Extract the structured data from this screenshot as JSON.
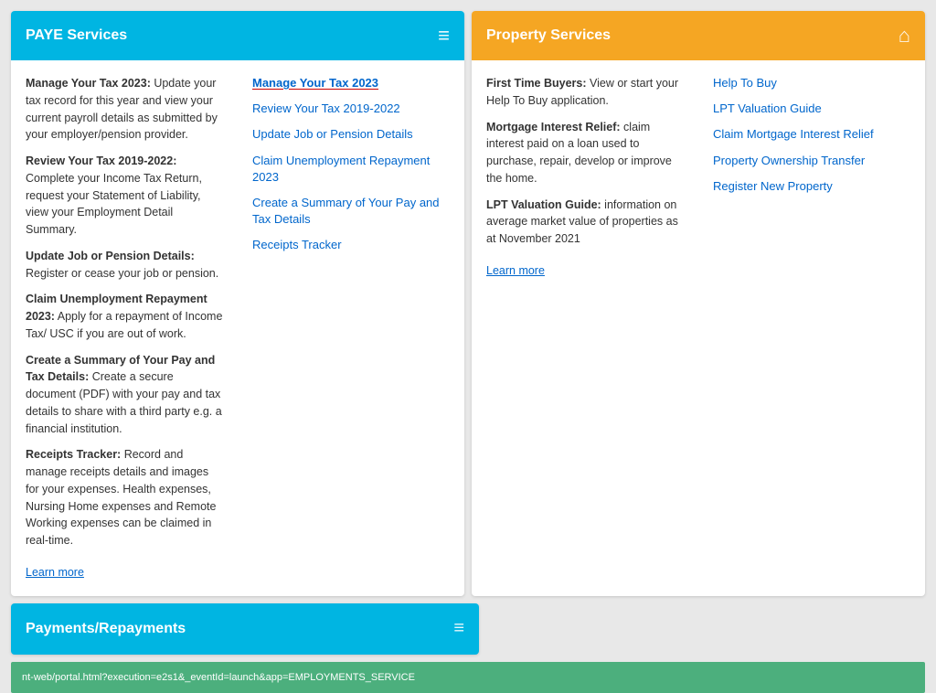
{
  "paye": {
    "header_title": "PAYE Services",
    "header_icon": "≡",
    "desc_items": [
      {
        "title": "Manage Your Tax 2023:",
        "text": " Update your tax record for this year and view your current payroll details as submitted by your employer/pension provider."
      },
      {
        "title": "Review Your Tax 2019-2022:",
        "text": " Complete your Income Tax Return, request your Statement of Liability, view your Employment Detail Summary."
      },
      {
        "title": "Update Job or Pension Details:",
        "text": " Register or cease your job or pension."
      },
      {
        "title": "Claim Unemployment Repayment 2023:",
        "text": " Apply for a repayment of Income Tax/ USC if you are out of work."
      },
      {
        "title": "Create a Summary of Your Pay and Tax Details:",
        "text": " Create a secure document (PDF) with your pay and tax details to share with a third party e.g. a financial institution."
      },
      {
        "title": "Receipts Tracker:",
        "text": " Record and manage receipts details and images for your expenses. Health expenses, Nursing Home expenses and Remote Working expenses can be claimed in real-time."
      }
    ],
    "learn_more": "Learn more",
    "links": [
      {
        "label": "Manage Your Tax 2023",
        "active": true
      },
      {
        "label": "Review Your Tax 2019-2022",
        "active": false
      },
      {
        "label": "Update Job or Pension Details",
        "active": false
      },
      {
        "label": "Claim Unemployment Repayment 2023",
        "active": false
      },
      {
        "label": "Create a Summary of Your Pay and Tax Details",
        "active": false
      },
      {
        "label": "Receipts Tracker",
        "active": false
      }
    ]
  },
  "property": {
    "header_title": "Property Services",
    "header_icon": "⌂",
    "desc_items": [
      {
        "title": "First Time Buyers:",
        "text": " View or start your Help To Buy application."
      },
      {
        "title": "Mortgage Interest Relief:",
        "text": " claim interest paid on a loan used to purchase, repair, develop or improve the home."
      },
      {
        "title": "LPT Valuation Guide:",
        "text": " information on average market value of properties as at November 2021"
      }
    ],
    "learn_more": "Learn more",
    "links": [
      {
        "label": "Help To Buy",
        "active": false
      },
      {
        "label": "LPT Valuation Guide",
        "active": false
      },
      {
        "label": "Claim Mortgage Interest Relief",
        "active": false
      },
      {
        "label": "Property Ownership Transfer",
        "active": false
      },
      {
        "label": "Register New Property",
        "active": false
      }
    ]
  },
  "bottom_left": {
    "title": "Payments/Repayments",
    "icon": "≡"
  },
  "statusbar": {
    "url": "nt-web/portal.html?execution=e2s1&_eventId=launch&app=EMPLOYMENTS_SERVICE"
  }
}
